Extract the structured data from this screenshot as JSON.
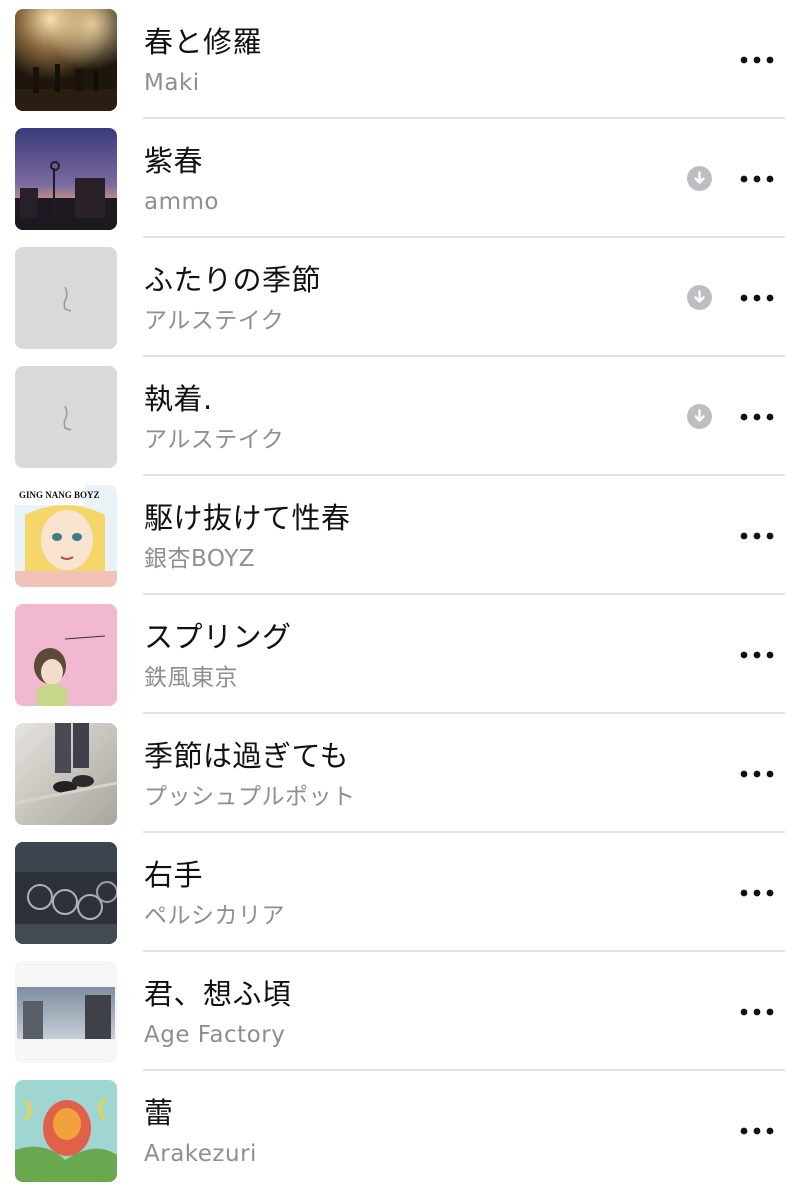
{
  "songs": [
    {
      "title": "春と修羅",
      "artist": "Maki",
      "downloaded": false,
      "artwork": "concert-stage-artwork"
    },
    {
      "title": "紫春",
      "artist": "ammo",
      "downloaded": true,
      "artwork": "purple-sky-street-artwork"
    },
    {
      "title": "ふたりの季節",
      "artist": "アルステイク",
      "downloaded": true,
      "artwork": "grey-sketch-artwork"
    },
    {
      "title": "執着.",
      "artist": "アルステイク",
      "downloaded": true,
      "artwork": "grey-sketch-artwork"
    },
    {
      "title": "駆け抜けて性春",
      "artist": "銀杏BOYZ",
      "downloaded": false,
      "artwork": "manga-girl-artwork",
      "artwork_text": "GING NANG BOYZ"
    },
    {
      "title": "スプリング",
      "artist": "鉄風東京",
      "downloaded": false,
      "artwork": "pink-illustration-artwork"
    },
    {
      "title": "季節は過ぎても",
      "artist": "プッシュプルポット",
      "downloaded": false,
      "artwork": "walking-feet-artwork"
    },
    {
      "title": "右手",
      "artist": "ペルシカリア",
      "downloaded": false,
      "artwork": "bicycles-artwork"
    },
    {
      "title": "君、想ふ頃",
      "artist": "Age Factory",
      "downloaded": false,
      "artwork": "building-sky-artwork"
    },
    {
      "title": "蕾",
      "artist": "Arakezuri",
      "downloaded": false,
      "artwork": "colorful-flower-artwork"
    }
  ],
  "icons": {
    "more": "more-options-icon",
    "download": "downloaded-icon"
  },
  "colors": {
    "title": "#111111",
    "subtitle": "#8e8e93",
    "download_badge": "#bdbdc2",
    "divider": "#e2e2e4"
  }
}
